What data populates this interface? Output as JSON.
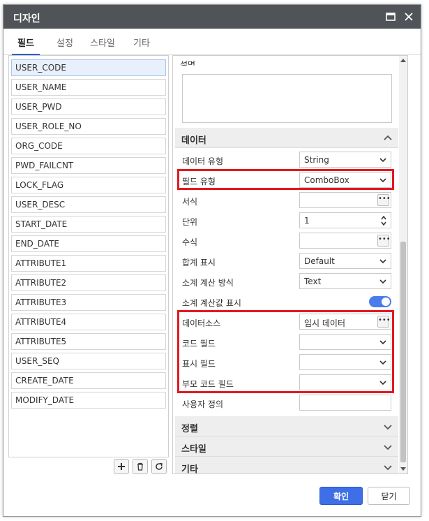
{
  "window": {
    "title": "디자인"
  },
  "tabs": [
    {
      "label": "필드",
      "active": true
    },
    {
      "label": "설정",
      "active": false
    },
    {
      "label": "스타일",
      "active": false
    },
    {
      "label": "기타",
      "active": false
    }
  ],
  "fields": [
    "USER_CODE",
    "USER_NAME",
    "USER_PWD",
    "USER_ROLE_NO",
    "ORG_CODE",
    "PWD_FAILCNT",
    "LOCK_FLAG",
    "USER_DESC",
    "START_DATE",
    "END_DATE",
    "ATTRIBUTE1",
    "ATTRIBUTE2",
    "ATTRIBUTE3",
    "ATTRIBUTE4",
    "ATTRIBUTE5",
    "USER_SEQ",
    "CREATE_DATE",
    "MODIFY_DATE"
  ],
  "selected_field": "USER_CODE",
  "list_buttons": {
    "add": "add-icon",
    "delete": "trash-icon",
    "refresh": "refresh-icon"
  },
  "props": {
    "memo_label": "설명",
    "data_section": "데이터",
    "data_type": {
      "label": "데이터 유형",
      "value": "String"
    },
    "field_type": {
      "label": "필드 유형",
      "value": "ComboBox"
    },
    "format": {
      "label": "서식",
      "value": ""
    },
    "unit": {
      "label": "단위",
      "value": "1"
    },
    "formula": {
      "label": "수식",
      "value": ""
    },
    "summary_display": {
      "label": "합계 표시",
      "value": "Default"
    },
    "subtotal_method": {
      "label": "소계 계산 방식",
      "value": "Text"
    },
    "subtotal_display": {
      "label": "소계 계산값 표시",
      "on": true
    },
    "datasource": {
      "label": "데이터소스",
      "value": "임시 데이터"
    },
    "code_field": {
      "label": "코드 필드",
      "value": ""
    },
    "display_field": {
      "label": "표시 필드",
      "value": ""
    },
    "parent_code_field": {
      "label": "부모 코드 필드",
      "value": ""
    },
    "user_defined": {
      "label": "사용자 정의",
      "value": ""
    },
    "sections": {
      "sort": "정렬",
      "style": "스타일",
      "etc": "기타"
    }
  },
  "buttons": {
    "ok": "확인",
    "close": "닫기"
  },
  "colors": {
    "titlebar": "#505458",
    "accent": "#3e6fe6",
    "highlight": "#e3191f",
    "toggle": "#4b7bec"
  }
}
